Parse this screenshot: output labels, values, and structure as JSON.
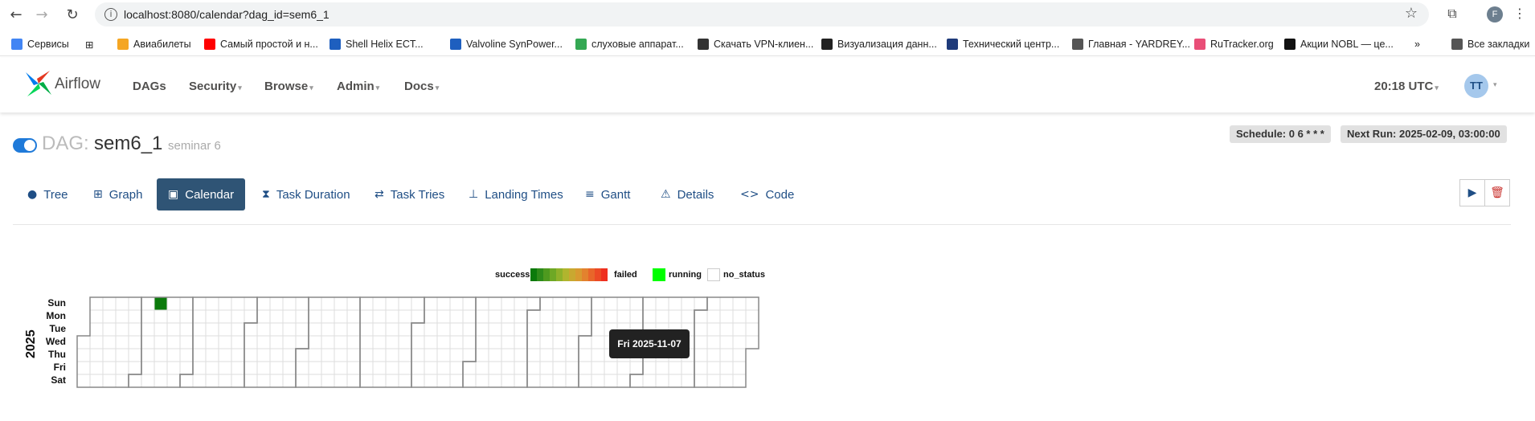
{
  "browser": {
    "url": "localhost:8080/calendar?dag_id=sem6_1",
    "profile_initial": "F"
  },
  "bookmarks": [
    {
      "label": "Сервисы",
      "color": "#4285f4"
    },
    {
      "label": "Авиабилеты",
      "color": "#f5a623"
    },
    {
      "label": "Самый простой и н...",
      "color": "#ff0000"
    },
    {
      "label": "Shell Helix ECT...",
      "color": "#1e5fbf"
    },
    {
      "label": "Valvoline SynPower...",
      "color": "#1e5fbf"
    },
    {
      "label": "слуховые аппарат...",
      "color": "#34a853"
    },
    {
      "label": "Скачать VPN-клиен...",
      "color": "#333333"
    },
    {
      "label": "Визуализация данн...",
      "color": "#222222"
    },
    {
      "label": "Технический центр...",
      "color": "#1f3b7a"
    },
    {
      "label": "Главная - YARDREY...",
      "color": "#555555"
    },
    {
      "label": "RuTracker.org",
      "color": "#e94e77"
    },
    {
      "label": "Акции NOBL — це...",
      "color": "#111111"
    },
    {
      "label": "Все закладки",
      "color": "#555555"
    }
  ],
  "airflow": {
    "logo_text": "Airflow",
    "menu": [
      "DAGs",
      "Security",
      "Browse",
      "Admin",
      "Docs"
    ],
    "clock": "20:18 UTC",
    "user_initials": "TT"
  },
  "dag": {
    "prefix": "DAG:",
    "id": "sem6_1",
    "description": "seminar 6",
    "schedule": "Schedule: 0 6 * * *",
    "next_run": "Next Run: 2025-02-09, 03:00:00"
  },
  "tabs": [
    {
      "label": "Tree",
      "icon": "tree-icon",
      "glyph": "●"
    },
    {
      "label": "Graph",
      "icon": "graph-icon",
      "glyph": "⊞"
    },
    {
      "label": "Calendar",
      "icon": "calendar-icon",
      "glyph": "▣"
    },
    {
      "label": "Task Duration",
      "icon": "hourglass-icon",
      "glyph": "⧗"
    },
    {
      "label": "Task Tries",
      "icon": "repeat-icon",
      "glyph": "⇄"
    },
    {
      "label": "Landing Times",
      "icon": "landing-icon",
      "glyph": "⊥"
    },
    {
      "label": "Gantt",
      "icon": "gantt-icon",
      "glyph": "≡"
    },
    {
      "label": "Details",
      "icon": "details-icon",
      "glyph": "⚠"
    },
    {
      "label": "Code",
      "icon": "code-icon",
      "glyph": "<>"
    }
  ],
  "active_tab": "Calendar",
  "legend": {
    "success": "success",
    "failed": "failed",
    "running": "running",
    "no_status": "no_status",
    "gradient": [
      "#0b7a0b",
      "#2e8b1a",
      "#4e9a1f",
      "#6ea825",
      "#8fb12a",
      "#b0b52e",
      "#c9a830",
      "#d89a30",
      "#e3822e",
      "#e8662a",
      "#ec4a25",
      "#ef2f1f"
    ],
    "running_color": "#00ff00"
  },
  "calendar": {
    "year": "2025",
    "day_labels": [
      "Sun",
      "Mon",
      "Tue",
      "Wed",
      "Thu",
      "Fri",
      "Sat"
    ],
    "success_cells": [
      {
        "week": 6,
        "day": 0
      }
    ],
    "success_color": "#0b7a0b"
  },
  "tooltip": "Fri 2025-11-07"
}
